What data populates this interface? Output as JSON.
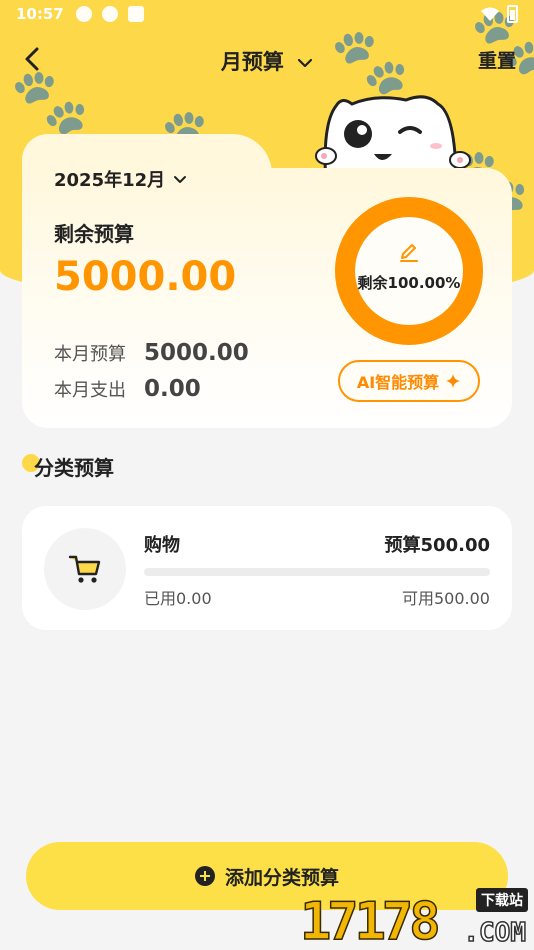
{
  "status_bar": {
    "time": "10:57"
  },
  "nav": {
    "title": "月预算",
    "reset_label": "重置"
  },
  "budget_card": {
    "month": "2025年12月",
    "remaining_label": "剩余预算",
    "remaining_amount": "5000.00",
    "remaining_percent_text": "剩余100.00%",
    "remaining_fraction": 1.0,
    "month_budget_label": "本月预算",
    "month_budget_value": "5000.00",
    "month_spend_label": "本月支出",
    "month_spend_value": "0.00",
    "ai_button_label": "AI智能预算"
  },
  "category_section": {
    "title": "分类预算",
    "items": [
      {
        "name": "购物",
        "icon": "shopping-cart-icon",
        "budget_text": "预算500.00",
        "used_text": "已用0.00",
        "available_text": "可用500.00",
        "used_fraction": 0.0
      }
    ]
  },
  "add_button": {
    "label": "添加分类预算"
  },
  "watermark": {
    "number": "17178",
    "suffix": ".COM",
    "tag": "下载站"
  },
  "colors": {
    "brand_yellow": "#fdd94a",
    "accent_orange": "#ff9500",
    "background": "#f4f4f4"
  }
}
